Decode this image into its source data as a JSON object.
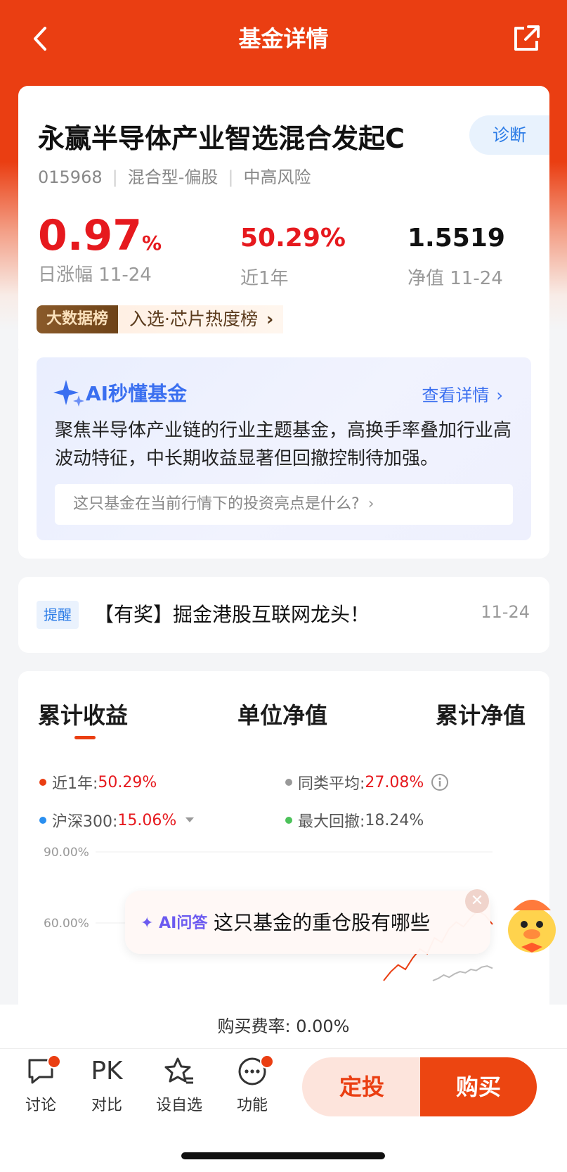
{
  "header": {
    "title": "基金详情"
  },
  "fund": {
    "name": "永赢半导体产业智选混合发起C",
    "diagnose_label": "诊断",
    "code": "015968",
    "type": "混合型-偏股",
    "risk": "中高风险",
    "daily_change": "0.97",
    "daily_change_unit": "%",
    "daily_change_label": "日涨幅 11-24",
    "year_return": "50.29%",
    "year_return_label": "近1年",
    "nav": "1.5519",
    "nav_label": "净值 11-24",
    "rank_tag": "大数据榜",
    "rank_text": "入选·芯片热度榜"
  },
  "ai_card": {
    "title": "AI秒懂基金",
    "more_label": "查看详情",
    "description": "聚焦半导体产业链的行业主题基金，高换手率叠加行业高波动特征，中长期收益显著但回撤控制待加强。",
    "question": "这只基金在当前行情下的投资亮点是什么?"
  },
  "notice": {
    "tag": "提醒",
    "text": "【有奖】掘金港股互联网龙头！",
    "date": "11-24"
  },
  "chart_tabs": [
    "累计收益",
    "单位净值",
    "累计净值"
  ],
  "legend": [
    {
      "label": "近1年:",
      "value": "50.29%",
      "color": "#ea3e12"
    },
    {
      "label": "同类平均:",
      "value": "27.08%",
      "color": "#999999"
    },
    {
      "label": "沪深300:",
      "value": "15.06%",
      "color": "#2a8ff0"
    },
    {
      "label": "最大回撤:",
      "value": "18.24%",
      "color": "#4cc25a"
    }
  ],
  "chart_data": {
    "type": "line",
    "y_tick_labels": [
      "90.00%",
      "60.00%"
    ],
    "series": [
      {
        "name": "近1年",
        "color": "#ea3e12",
        "values": [
          0,
          8,
          14,
          10,
          20,
          28,
          24,
          38,
          34,
          46,
          52,
          48,
          56,
          62,
          58,
          50
        ]
      },
      {
        "name": "同类平均",
        "color": "#bbbbbb",
        "values": [
          0,
          2,
          5,
          3,
          6,
          8,
          7,
          10,
          9,
          12,
          13,
          11
        ]
      }
    ]
  },
  "ai_bubble": {
    "tag": "AI问答",
    "question": "这只基金的重仓股有哪些"
  },
  "fee": {
    "text": "购买费率: 0.00%"
  },
  "bottom_bar": {
    "discuss": "讨论",
    "compare_icon": "PK",
    "compare": "对比",
    "watchlist": "设自选",
    "functions": "功能",
    "sip": "定投",
    "buy": "购买"
  }
}
